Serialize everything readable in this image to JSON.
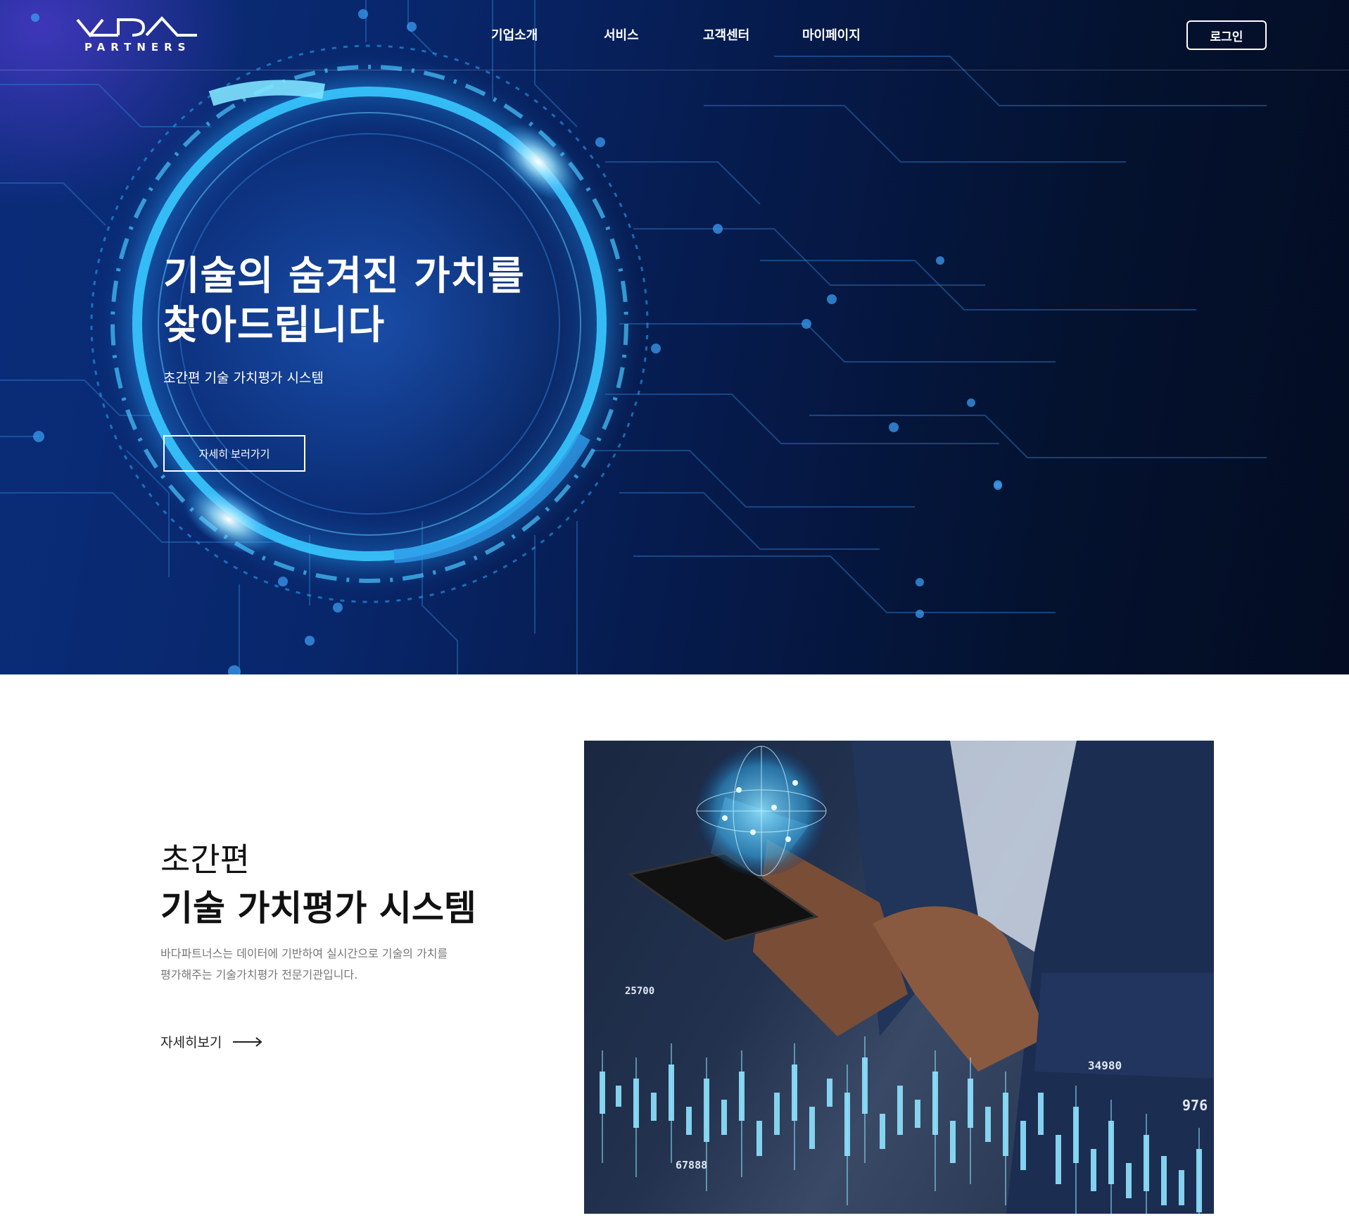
{
  "header": {
    "logo_text": "PARTNERS",
    "nav": [
      {
        "label": "기업소개"
      },
      {
        "label": "서비스"
      },
      {
        "label": "고객센터"
      },
      {
        "label": "마이페이지"
      }
    ],
    "login_label": "로그인"
  },
  "hero": {
    "title_line1": "기술의 숨겨진 가치를",
    "title_line2": "찾아드립니다",
    "subtitle": "초간편 기술 가치평가 시스템",
    "button_label": "자세히 보러가기"
  },
  "intro": {
    "heading_light": "초간편",
    "heading_bold": "기술 가치평가 시스템",
    "description_line1": "바다파트너스는 데이터에 기반하여 실시간으로 기술의 가치를",
    "description_line2": "평가해주는 기술가치평가 전문기관입니다.",
    "more_label": "자세히보기"
  },
  "photo": {
    "numbers": [
      "25700",
      "34980",
      "976",
      "67888"
    ]
  },
  "colors": {
    "hero_dark": "#04122f",
    "hero_blue": "#0a2d7a",
    "ring_cyan": "#35c8ff"
  }
}
